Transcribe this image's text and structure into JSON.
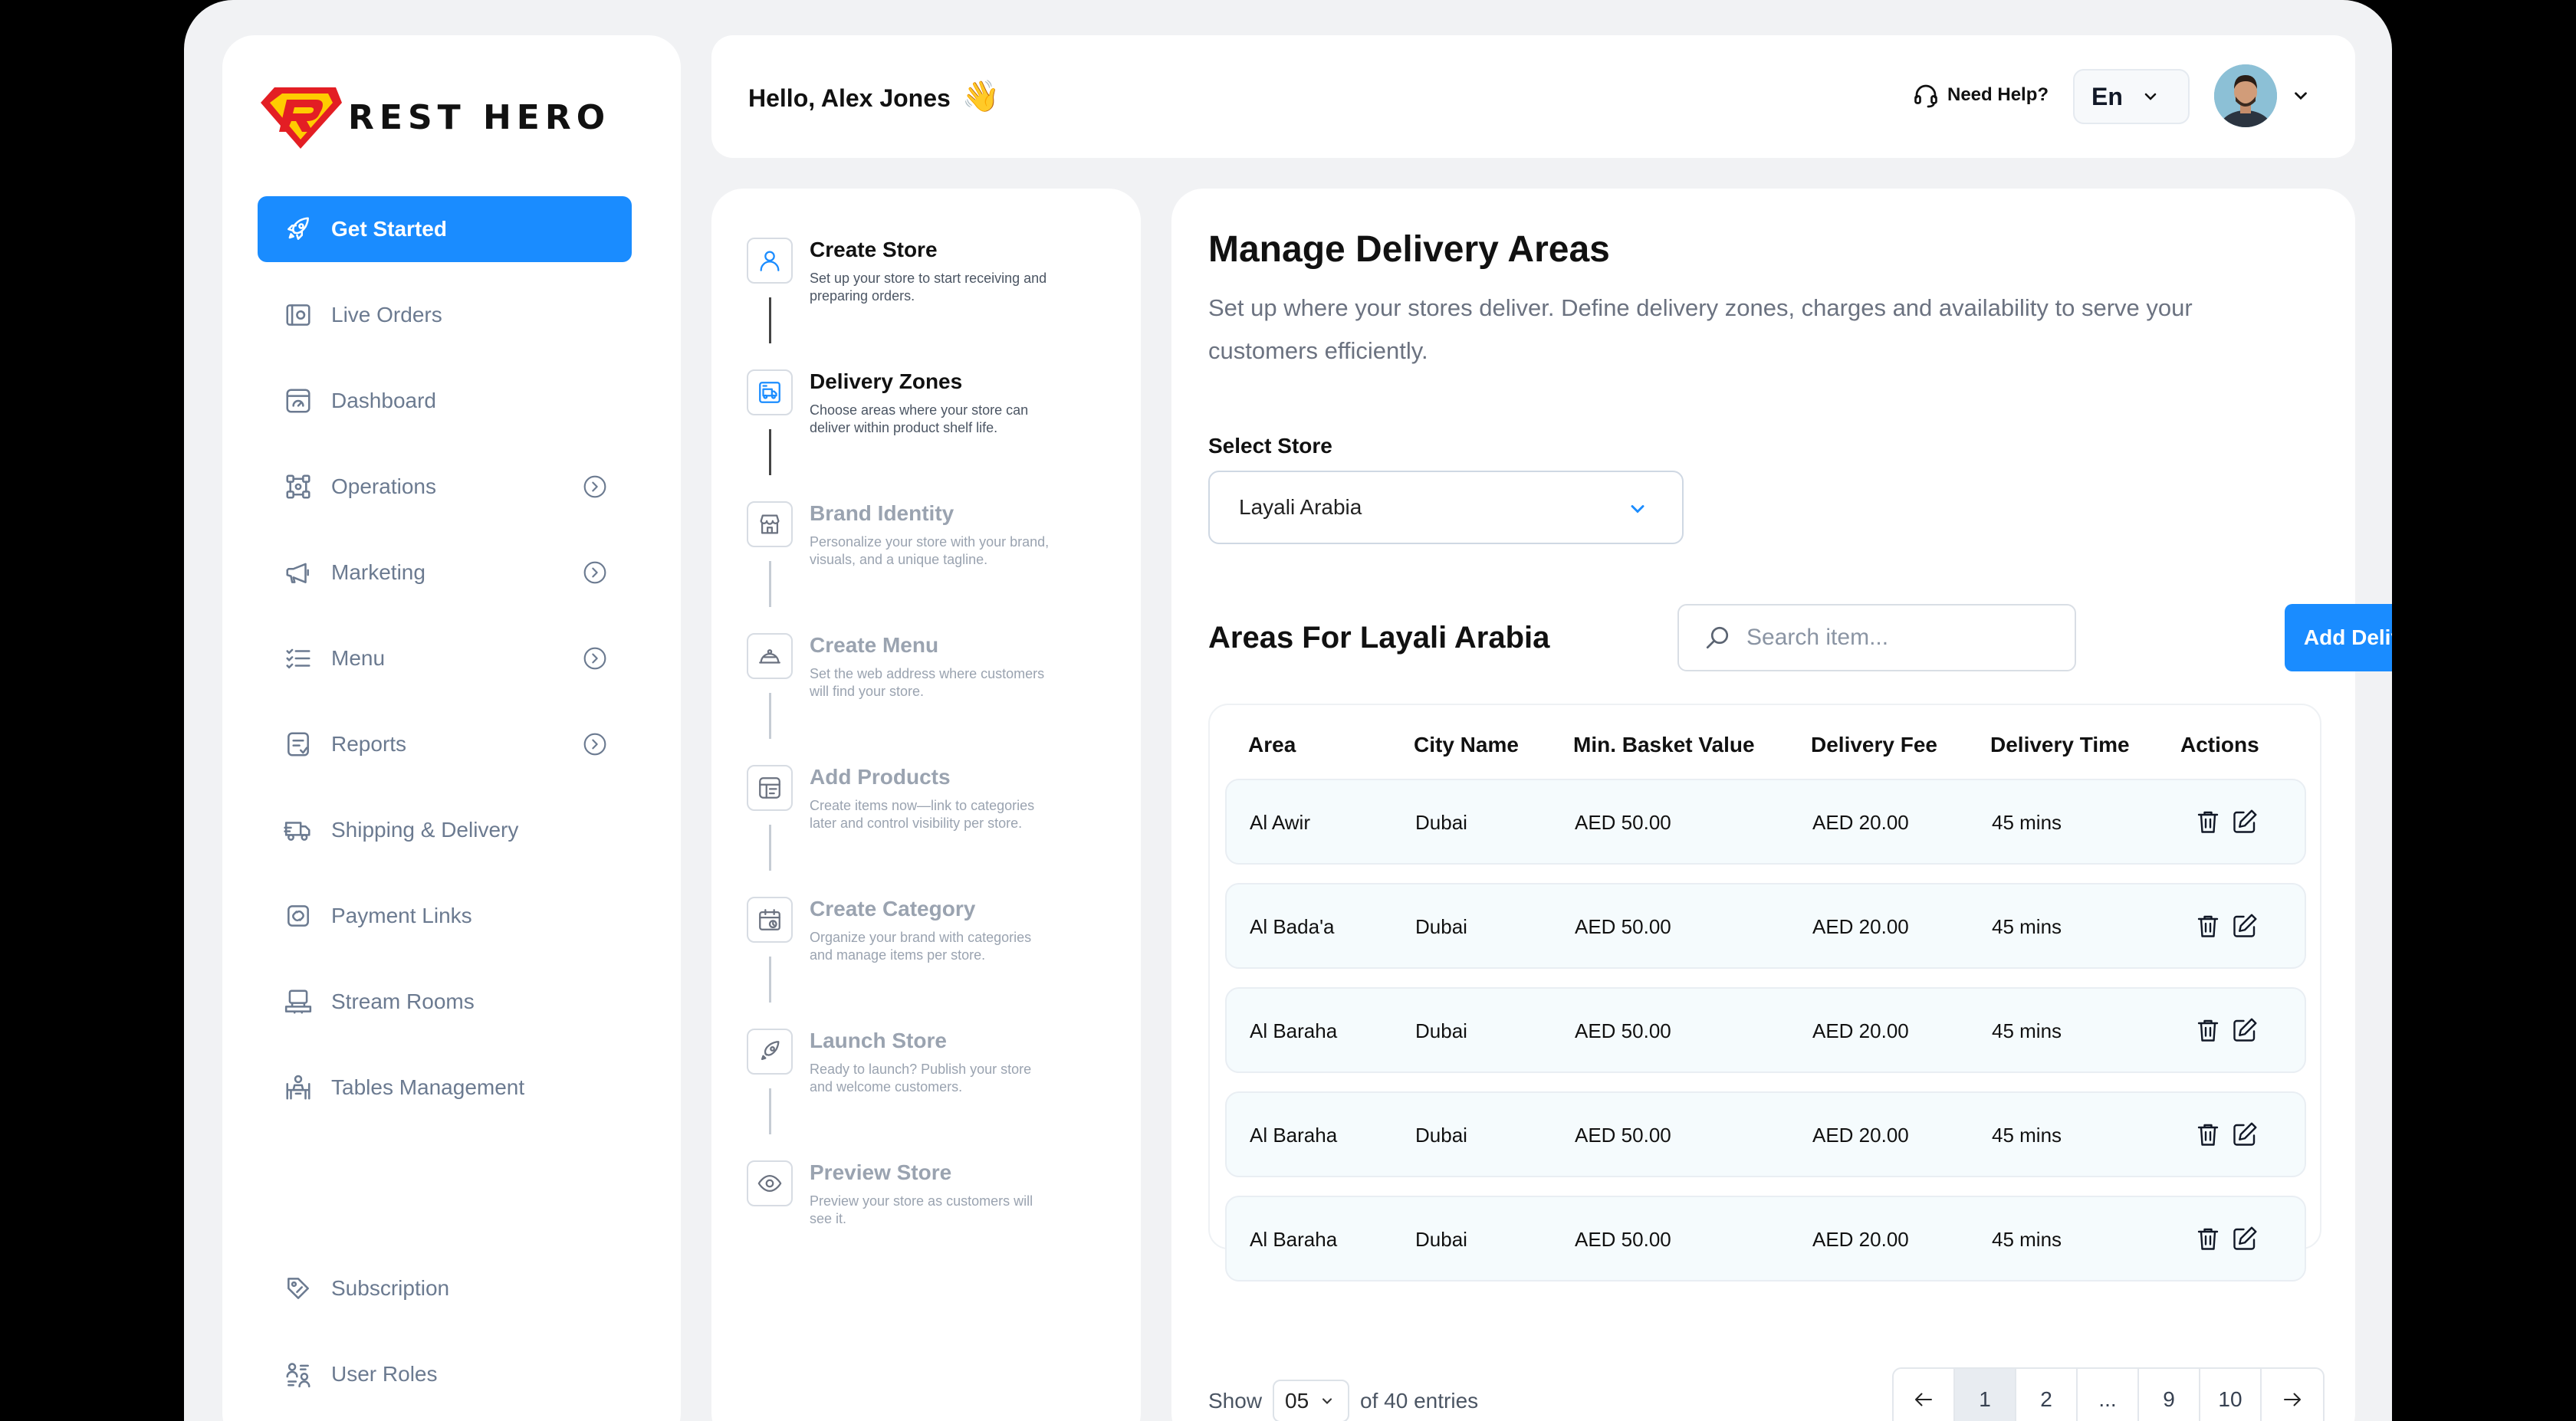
{
  "brand": {
    "name": "REST HERO"
  },
  "sidebar": {
    "items": [
      {
        "label": "Get Started",
        "icon": "rocket-icon",
        "active": true
      },
      {
        "label": "Live Orders",
        "icon": "live-orders-icon"
      },
      {
        "label": "Dashboard",
        "icon": "dashboard-icon"
      },
      {
        "label": "Operations",
        "icon": "operations-icon",
        "expandable": true
      },
      {
        "label": "Marketing",
        "icon": "megaphone-icon",
        "expandable": true
      },
      {
        "label": "Menu",
        "icon": "menu-list-icon",
        "expandable": true
      },
      {
        "label": "Reports",
        "icon": "reports-icon",
        "expandable": true
      },
      {
        "label": "Shipping & Delivery",
        "icon": "truck-icon"
      },
      {
        "label": "Payment Links",
        "icon": "payment-link-icon"
      },
      {
        "label": "Stream Rooms",
        "icon": "stream-room-icon"
      },
      {
        "label": "Tables Management",
        "icon": "tables-icon"
      }
    ],
    "bottom_items": [
      {
        "label": "Subscription",
        "icon": "tag-icon"
      },
      {
        "label": "User Roles",
        "icon": "user-roles-icon"
      }
    ]
  },
  "header": {
    "greeting": "Hello, Alex Jones",
    "wave": "👋",
    "help": "Need Help?",
    "language": "En"
  },
  "steps": [
    {
      "title": "Create Store",
      "desc": "Set up your store to start receiving and preparing orders.",
      "icon": "user-icon",
      "active": true
    },
    {
      "title": "Delivery Zones",
      "desc": "Choose areas where your store can deliver within product shelf life.",
      "icon": "delivery-zone-icon",
      "active": true
    },
    {
      "title": "Brand Identity",
      "desc": "Personalize your store with your brand, visuals, and a unique tagline.",
      "icon": "storefront-icon"
    },
    {
      "title": "Create Menu",
      "desc": "Set the web address where customers will find your store.",
      "icon": "cloche-icon"
    },
    {
      "title": "Add Products",
      "desc": "Create items now—link to categories later and control visibility per store.",
      "icon": "products-icon"
    },
    {
      "title": "Create Category",
      "desc": "Organize your brand with categories and manage items per store.",
      "icon": "category-icon"
    },
    {
      "title": "Launch Store",
      "desc": "Ready to launch? Publish your store and welcome customers.",
      "icon": "launch-icon"
    },
    {
      "title": "Preview Store",
      "desc": "Preview your store as customers will see it.",
      "icon": "eye-icon"
    }
  ],
  "main": {
    "title": "Manage Delivery Areas",
    "description": "Set up where your stores deliver. Define delivery zones, charges and availability to serve your customers efficiently.",
    "select_label": "Select Store",
    "selected_store": "Layali Arabia",
    "areas_title": "Areas For Layali Arabia",
    "search_placeholder": "Search item...",
    "add_button": "Add Delivery Area",
    "columns": [
      "Area",
      "City Name",
      "Min. Basket Value",
      "Delivery Fee",
      "Delivery Time",
      "Actions"
    ],
    "rows": [
      [
        "Al Awir",
        "Dubai",
        "AED 50.00",
        "AED 20.00",
        "45 mins"
      ],
      [
        "Al Bada'a",
        "Dubai",
        "AED 50.00",
        "AED 20.00",
        "45 mins"
      ],
      [
        "Al Baraha",
        "Dubai",
        "AED 50.00",
        "AED 20.00",
        "45 mins"
      ],
      [
        "Al Baraha",
        "Dubai",
        "AED 50.00",
        "AED 20.00",
        "45 mins"
      ],
      [
        "Al Baraha",
        "Dubai",
        "AED 50.00",
        "AED 20.00",
        "45 mins"
      ]
    ],
    "show_label": "Show",
    "page_size": "05",
    "entries_label": "of 40 entries",
    "pages": [
      "1",
      "2",
      "...",
      "9",
      "10"
    ],
    "current_page": "1"
  },
  "colors": {
    "accent": "#1a8cff",
    "logo_red": "#e31e24",
    "logo_yellow": "#ffcc00"
  }
}
